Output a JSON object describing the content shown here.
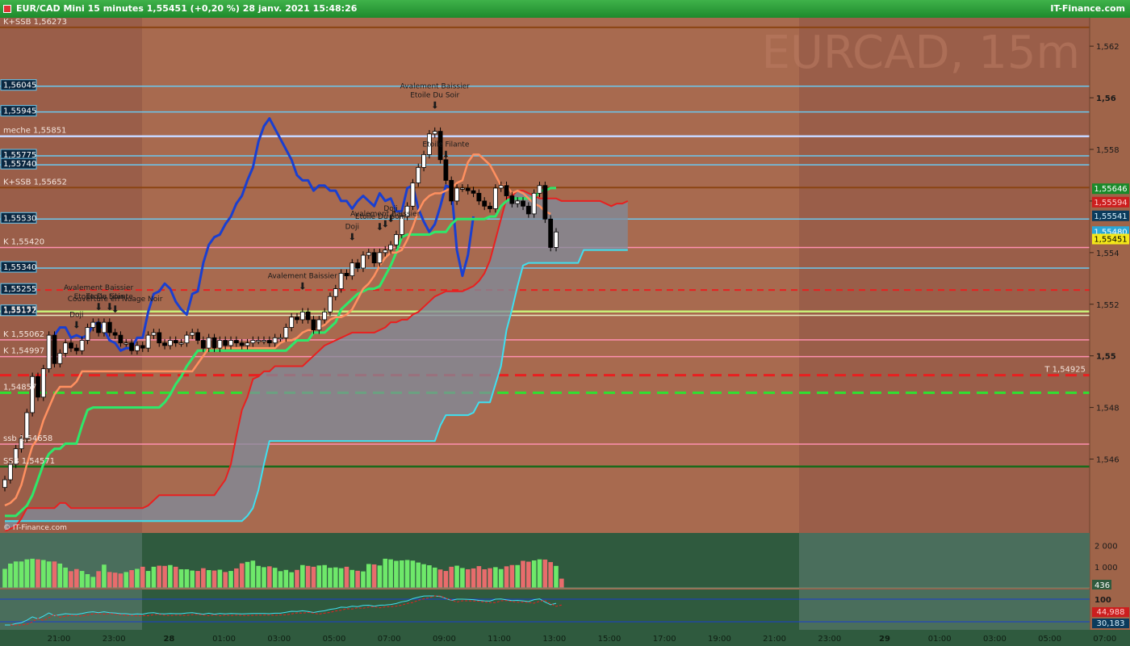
{
  "titlebar": {
    "title": "EUR/CAD Mini 15 minutes 1,55451 (+0,20 %) 28 janv. 2021 15:48:26",
    "brand": "IT-Finance.com"
  },
  "watermark": "EURCAD, 15m",
  "copyright": "© IT-Finance.com",
  "colors": {
    "bg_main": "#a86a4f",
    "bg_shade": "#9a5e49",
    "kijun": "#ff9060",
    "tenkan": "#2ee86a",
    "chikou": "#1a3fd0",
    "ssa": "#e82020",
    "ssb": "#3fe0f0",
    "cloud": "#7f8c9c",
    "bull_vol": "#6ee86a",
    "bear_vol": "#e86c6c"
  },
  "price_axis": {
    "ticks": [
      "1,562",
      "1,56",
      "1,558",
      "1,556",
      "1,554",
      "1,552",
      "1,55",
      "1,548",
      "1,546"
    ],
    "last_price": "1,55451"
  },
  "right_labels": [
    {
      "text": "1,55646",
      "price": 1.55646,
      "bg": "#1a8a2a",
      "fg": "#ffffff"
    },
    {
      "text": "1,55594",
      "price": 1.55594,
      "bg": "#cc1e1e",
      "fg": "#ffcccc"
    },
    {
      "text": "1,55541",
      "price": 1.55541,
      "bg": "#0b3b5c",
      "fg": "#d9f2ff"
    },
    {
      "text": "1,55480",
      "price": 1.5548,
      "bg": "#2aa7d8",
      "fg": "#ffffff"
    },
    {
      "text": "1,55451",
      "price": 1.55451,
      "bg": "#f4e81a",
      "fg": "#000000"
    }
  ],
  "time_axis": [
    "21:00",
    "23:00",
    "28",
    "01:00",
    "03:00",
    "05:00",
    "07:00",
    "09:00",
    "11:00",
    "13:00",
    "15:00",
    "17:00",
    "19:00",
    "21:00",
    "23:00",
    "29",
    "01:00",
    "03:00",
    "05:00",
    "07:00",
    "09:00"
  ],
  "levels": [
    {
      "label": "K+SSB 1,56273",
      "price": 1.56273,
      "color": "#8b4513",
      "width": 2,
      "dash": "",
      "boxed": false
    },
    {
      "label": "1,56045",
      "price": 1.56045,
      "color": "#6ac8f0",
      "width": 1.5,
      "dash": "",
      "boxed": true
    },
    {
      "label": "1,55945",
      "price": 1.55945,
      "color": "#6ac8f0",
      "width": 1.5,
      "dash": "",
      "boxed": true
    },
    {
      "label": "meche 1,55851",
      "price": 1.55851,
      "color": "#c6d6ff",
      "width": 2.5,
      "dash": "",
      "boxed": false
    },
    {
      "label": "1,55775",
      "price": 1.55775,
      "color": "#6ac8f0",
      "width": 1.5,
      "dash": "",
      "boxed": true
    },
    {
      "label": "1,55740",
      "price": 1.5574,
      "color": "#6ac8f0",
      "width": 1.5,
      "dash": "",
      "boxed": true
    },
    {
      "label": "K+SSB 1,55652",
      "price": 1.55652,
      "color": "#8b4513",
      "width": 2,
      "dash": "",
      "boxed": false
    },
    {
      "label": "1,55530",
      "price": 1.5553,
      "color": "#6ac8f0",
      "width": 1.5,
      "dash": "",
      "boxed": true
    },
    {
      "label": "K 1,55420",
      "price": 1.5542,
      "color": "#ff8fb0",
      "width": 1.5,
      "dash": "",
      "boxed": false
    },
    {
      "label": "1,55340",
      "price": 1.5534,
      "color": "#6ac8f0",
      "width": 1.5,
      "dash": "",
      "boxed": true
    },
    {
      "label": "1,55255",
      "price": 1.55255,
      "color": "#e82020",
      "width": 2,
      "dash": "8,6",
      "boxed": true
    },
    {
      "label": "1,55172",
      "price": 1.55172,
      "color": "#c8f078",
      "width": 2.5,
      "dash": "",
      "boxed": true
    },
    {
      "label": "1,55157",
      "price": 1.55157,
      "color": "#e8e8c0",
      "width": 1.5,
      "dash": "",
      "boxed": false
    },
    {
      "label": "K 1,55062",
      "price": 1.55062,
      "color": "#ff8fb0",
      "width": 1.5,
      "dash": "",
      "boxed": false
    },
    {
      "label": "K 1,54997",
      "price": 1.54997,
      "color": "#ff8fb0",
      "width": 1.5,
      "dash": "",
      "boxed": false
    },
    {
      "label": "T 1,54925",
      "price": 1.54925,
      "color": "#e82020",
      "width": 3,
      "dash": "14,8",
      "boxed": false
    },
    {
      "label": "1,54857",
      "price": 1.54857,
      "color": "#30e030",
      "width": 3,
      "dash": "14,8",
      "boxed": false
    },
    {
      "label": "ssb 1,54658",
      "price": 1.54658,
      "color": "#ff8fb0",
      "width": 1.5,
      "dash": "",
      "boxed": false
    },
    {
      "label": "SSB 1,54571",
      "price": 1.54571,
      "color": "#1a6a1a",
      "width": 2.5,
      "dash": "",
      "boxed": false
    }
  ],
  "annotations": [
    {
      "text": "Etoile Du Soir",
      "idx": 17
    },
    {
      "text": "Avalement Baissier",
      "idx": 17
    },
    {
      "text": "Etoile Filante",
      "idx": 19
    },
    {
      "text": "Couverture en Nuage Noir",
      "idx": 20
    },
    {
      "text": "Doji",
      "idx": 13
    },
    {
      "text": "Avalement Baissier",
      "idx": 54
    },
    {
      "text": "Doji",
      "idx": 63
    },
    {
      "text": "Etoile Du Soir",
      "idx": 68
    },
    {
      "text": "Avalement Baissier",
      "idx": 69
    },
    {
      "text": "Doji",
      "idx": 70
    },
    {
      "text": "Etoile Du Soir",
      "idx": 78
    },
    {
      "text": "Avalement Baissier",
      "idx": 78
    },
    {
      "text": "Etoile Filante",
      "idx": 80
    }
  ],
  "volume": {
    "ticks": [
      "2 000",
      "1 000"
    ],
    "last": "436"
  },
  "oscillator": {
    "ticks": [
      "100"
    ],
    "values": [
      "44,988",
      "30,183"
    ]
  },
  "chart_data": {
    "type": "candlestick",
    "title": "EUR/CAD Mini 15 minutes",
    "interval_minutes": 15,
    "first_bar_time": "2021-01-27 19:45",
    "ylim": [
      1.5432,
      1.5631
    ],
    "close": [
      1.5452,
      1.5458,
      1.5464,
      1.5468,
      1.5478,
      1.5492,
      1.5484,
      1.5495,
      1.5508,
      1.5497,
      1.5501,
      1.5505,
      1.5503,
      1.5502,
      1.5506,
      1.5511,
      1.5513,
      1.5509,
      1.5513,
      1.5509,
      1.5508,
      1.5505,
      1.5505,
      1.5502,
      1.5504,
      1.5503,
      1.5508,
      1.5509,
      1.5505,
      1.5504,
      1.5506,
      1.5505,
      1.5505,
      1.5508,
      1.5509,
      1.5506,
      1.5503,
      1.5507,
      1.5503,
      1.5506,
      1.5504,
      1.5506,
      1.5505,
      1.5504,
      1.5505,
      1.5506,
      1.5506,
      1.5506,
      1.5505,
      1.5507,
      1.5507,
      1.5511,
      1.5515,
      1.5514,
      1.5517,
      1.5514,
      1.551,
      1.5514,
      1.5517,
      1.5523,
      1.5526,
      1.5532,
      1.5531,
      1.5536,
      1.5534,
      1.5539,
      1.554,
      1.5536,
      1.554,
      1.5541,
      1.5543,
      1.5547,
      1.5554,
      1.5558,
      1.5567,
      1.5573,
      1.5578,
      1.5586,
      1.5587,
      1.5576,
      1.5568,
      1.556,
      1.5565,
      1.5565,
      1.5564,
      1.5563,
      1.556,
      1.5558,
      1.5557,
      1.5565,
      1.5566,
      1.5562,
      1.5559,
      1.556,
      1.5558,
      1.5555,
      1.5563,
      1.5566,
      1.5553,
      1.5542,
      1.5548
    ],
    "ssa": [
      1.5432,
      1.5433,
      1.5434,
      1.5437,
      1.5441,
      1.5441,
      1.5441,
      1.5441,
      1.5441,
      1.5441,
      1.5443,
      1.5443,
      1.5441,
      1.5441,
      1.5441,
      1.5441,
      1.5441,
      1.5441,
      1.5441,
      1.5441,
      1.5441,
      1.5441,
      1.5441,
      1.5441,
      1.5441,
      1.5441,
      1.5442,
      1.5444,
      1.5446,
      1.5446,
      1.5446,
      1.5446,
      1.5446,
      1.5446,
      1.5446,
      1.5446,
      1.5446,
      1.5446,
      1.5446,
      1.5449,
      1.5452,
      1.5458,
      1.5469,
      1.5479,
      1.5484,
      1.5491,
      1.5492,
      1.5494,
      1.5494,
      1.5496,
      1.5496,
      1.5496,
      1.5496,
      1.5496,
      1.5496,
      1.5498,
      1.55,
      1.5502,
      1.5504,
      1.5505,
      1.5506,
      1.5507,
      1.5508,
      1.5509,
      1.5509,
      1.5509,
      1.5509,
      1.5509,
      1.551,
      1.5511,
      1.5513,
      1.5513,
      1.5514,
      1.5514,
      1.5516,
      1.5517,
      1.5519,
      1.5521,
      1.5523,
      1.5524,
      1.5525,
      1.5525,
      1.5525,
      1.5525,
      1.5526,
      1.5527,
      1.5529,
      1.5532,
      1.5537,
      1.5545,
      1.5553,
      1.5561,
      1.5562,
      1.5564,
      1.5564,
      1.5563,
      1.5562,
      1.5561,
      1.5561,
      1.5561,
      1.5561,
      1.556,
      1.556,
      1.556,
      1.556,
      1.556,
      1.556,
      1.556,
      1.556,
      1.5559,
      1.5558,
      1.5559,
      1.5559,
      1.556
    ],
    "ssb": [
      1.5436,
      1.5436,
      1.5436,
      1.5436,
      1.5436,
      1.5436,
      1.5436,
      1.5436,
      1.5436,
      1.5436,
      1.5436,
      1.5436,
      1.5436,
      1.5436,
      1.5436,
      1.5436,
      1.5436,
      1.5436,
      1.5436,
      1.5436,
      1.5436,
      1.5436,
      1.5436,
      1.5436,
      1.5436,
      1.5436,
      1.5436,
      1.5436,
      1.5436,
      1.5436,
      1.5436,
      1.5436,
      1.5436,
      1.5436,
      1.5436,
      1.5436,
      1.5436,
      1.5436,
      1.5436,
      1.5436,
      1.5436,
      1.5436,
      1.5436,
      1.5436,
      1.5438,
      1.5441,
      1.5448,
      1.5458,
      1.5467,
      1.5467,
      1.5467,
      1.5467,
      1.5467,
      1.5467,
      1.5467,
      1.5467,
      1.5467,
      1.5467,
      1.5467,
      1.5467,
      1.5467,
      1.5467,
      1.5467,
      1.5467,
      1.5467,
      1.5467,
      1.5467,
      1.5467,
      1.5467,
      1.5467,
      1.5467,
      1.5467,
      1.5467,
      1.5467,
      1.5467,
      1.5467,
      1.5467,
      1.5467,
      1.5467,
      1.5473,
      1.5477,
      1.5477,
      1.5477,
      1.5477,
      1.5477,
      1.5478,
      1.5482,
      1.5482,
      1.5482,
      1.5489,
      1.5496,
      1.551,
      1.5518,
      1.5527,
      1.5535,
      1.5536,
      1.5536,
      1.5536,
      1.5536,
      1.5536,
      1.5536,
      1.5536,
      1.5536,
      1.5536,
      1.5536,
      1.5541,
      1.5541,
      1.5541,
      1.5541,
      1.5541,
      1.5541,
      1.5541,
      1.5541,
      1.5541
    ],
    "kijun": [
      1.5442,
      1.5443,
      1.5445,
      1.545,
      1.5458,
      1.5465,
      1.5468,
      1.5475,
      1.548,
      1.5485,
      1.5488,
      1.5488,
      1.5488,
      1.549,
      1.5494,
      1.5494,
      1.5494,
      1.5494,
      1.5494,
      1.5494,
      1.5494,
      1.5494,
      1.5494,
      1.5494,
      1.5494,
      1.5494,
      1.5494,
      1.5494,
      1.5494,
      1.5494,
      1.5494,
      1.5494,
      1.5494,
      1.5494,
      1.5494,
      1.5497,
      1.55,
      1.5503,
      1.5503,
      1.5503,
      1.5503,
      1.5503,
      1.5503,
      1.5503,
      1.5503,
      1.5503,
      1.5503,
      1.5503,
      1.5503,
      1.5503,
      1.5505,
      1.5506,
      1.5506,
      1.5507,
      1.5509,
      1.551,
      1.551,
      1.5511,
      1.5512,
      1.5514,
      1.5515,
      1.5515,
      1.5516,
      1.5518,
      1.5522,
      1.5526,
      1.5528,
      1.5531,
      1.5535,
      1.5538,
      1.554,
      1.554,
      1.5541,
      1.5545,
      1.555,
      1.5556,
      1.556,
      1.5562,
      1.5563,
      1.5563,
      1.5564,
      1.5565,
      1.5567,
      1.5568,
      1.5575,
      1.5578,
      1.5578,
      1.5576,
      1.5574,
      1.557,
      1.5566,
      1.5566,
      1.5563,
      1.5564,
      1.5563,
      1.5561,
      1.5559,
      1.5558,
      1.5556,
      1.5555
    ],
    "tenkan": [
      1.5438,
      1.5438,
      1.5438,
      1.544,
      1.5442,
      1.5446,
      1.5452,
      1.5458,
      1.5462,
      1.5464,
      1.5464,
      1.5466,
      1.5466,
      1.5466,
      1.5473,
      1.5479,
      1.548,
      1.548,
      1.548,
      1.548,
      1.548,
      1.548,
      1.548,
      1.548,
      1.548,
      1.548,
      1.548,
      1.548,
      1.548,
      1.5482,
      1.5485,
      1.5489,
      1.5492,
      1.5496,
      1.5499,
      1.5502,
      1.5502,
      1.5502,
      1.5502,
      1.5502,
      1.5502,
      1.5502,
      1.5502,
      1.5502,
      1.5502,
      1.5502,
      1.5502,
      1.5502,
      1.5502,
      1.5502,
      1.5502,
      1.5502,
      1.5504,
      1.5506,
      1.5506,
      1.5506,
      1.5509,
      1.5509,
      1.5509,
      1.5511,
      1.5513,
      1.5518,
      1.552,
      1.5522,
      1.5524,
      1.5525,
      1.5526,
      1.5526,
      1.5527,
      1.5531,
      1.5535,
      1.554,
      1.5546,
      1.5547,
      1.5547,
      1.5547,
      1.5547,
      1.5547,
      1.5548,
      1.5548,
      1.5548,
      1.5551,
      1.5553,
      1.5553,
      1.5553,
      1.5553,
      1.5553,
      1.5553,
      1.5554,
      1.5554,
      1.5558,
      1.556,
      1.5561,
      1.5561,
      1.5561,
      1.5561,
      1.5561,
      1.5564,
      1.5564,
      1.5565,
      1.5565
    ],
    "chikou": [
      1.5508,
      1.5511,
      1.5511,
      1.5507,
      1.5508,
      1.5507,
      1.5508,
      1.5512,
      1.5513,
      1.551,
      1.5506,
      1.5505,
      1.5502,
      1.5503,
      1.5503,
      1.5507,
      1.5507,
      1.5517,
      1.5524,
      1.5525,
      1.5528,
      1.5526,
      1.5521,
      1.5518,
      1.5516,
      1.5524,
      1.5525,
      1.5536,
      1.5543,
      1.5546,
      1.5547,
      1.5551,
      1.5554,
      1.5559,
      1.5562,
      1.5568,
      1.5573,
      1.5583,
      1.5589,
      1.5592,
      1.5588,
      1.5584,
      1.558,
      1.5576,
      1.557,
      1.5568,
      1.5568,
      1.5564,
      1.5566,
      1.5566,
      1.5564,
      1.5564,
      1.556,
      1.556,
      1.5557,
      1.556,
      1.5562,
      1.556,
      1.5558,
      1.5563,
      1.556,
      1.5561,
      1.5556,
      1.5556,
      1.5565,
      1.5566,
      1.5557,
      1.5552,
      1.5548,
      1.5551,
      1.5558,
      1.5566,
      1.5565,
      1.5541,
      1.5531,
      1.5539,
      1.5554
    ],
    "volume": [
      900,
      1150,
      1250,
      1250,
      1350,
      1380,
      1350,
      1320,
      1250,
      1250,
      1150,
      960,
      790,
      890,
      800,
      650,
      520,
      790,
      1100,
      750,
      720,
      680,
      750,
      840,
      900,
      1000,
      800,
      1000,
      1050,
      1040,
      1080,
      1000,
      880,
      880,
      820,
      800,
      930,
      840,
      820,
      860,
      750,
      800,
      920,
      1160,
      1230,
      1290,
      1040,
      980,
      1020,
      950,
      790,
      850,
      740,
      850,
      1080,
      1040,
      1000,
      1060,
      1080,
      950,
      970,
      930,
      1000,
      850,
      810,
      780,
      1130,
      1110,
      1060,
      1380,
      1350,
      1280,
      1300,
      1320,
      1290,
      1200,
      1120,
      1070,
      960,
      870,
      800,
      1000,
      1050,
      940,
      880,
      920,
      1030,
      880,
      930,
      980,
      890,
      1020,
      1080,
      1080,
      1280,
      1240,
      1300,
      1350,
      1340,
      1220,
      1040,
      436
    ],
    "xlabel": "",
    "ylabel": ""
  }
}
